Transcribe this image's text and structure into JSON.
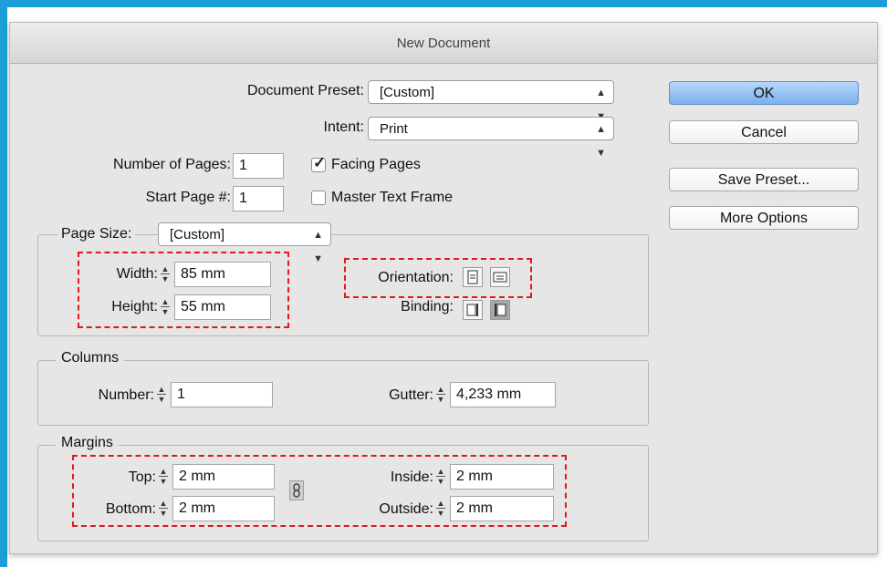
{
  "dialog": {
    "title": "New Document"
  },
  "document_preset": {
    "label": "Document Preset:",
    "value": "[Custom]"
  },
  "intent": {
    "label": "Intent:",
    "value": "Print"
  },
  "number_of_pages": {
    "label": "Number of Pages:",
    "value": "1"
  },
  "start_page": {
    "label": "Start Page #:",
    "value": "1"
  },
  "facing_pages": {
    "label": "Facing Pages",
    "checked": true
  },
  "master_text_frame": {
    "label": "Master Text Frame",
    "checked": false
  },
  "buttons": {
    "ok": "OK",
    "cancel": "Cancel",
    "save_preset": "Save Preset...",
    "more_options": "More Options"
  },
  "page_size": {
    "label": "Page Size:",
    "value": "[Custom]",
    "width": {
      "label": "Width:",
      "value": "85 mm"
    },
    "height": {
      "label": "Height:",
      "value": "55 mm"
    },
    "orientation": {
      "label": "Orientation:",
      "icons": [
        "portrait-orientation-icon",
        "landscape-orientation-icon"
      ]
    },
    "binding": {
      "label": "Binding:",
      "icons": [
        "left-to-right-binding-icon",
        "right-to-left-binding-icon"
      ],
      "selected": 1
    }
  },
  "columns": {
    "title": "Columns",
    "number": {
      "label": "Number:",
      "value": "1"
    },
    "gutter": {
      "label": "Gutter:",
      "value": "4,233 mm"
    }
  },
  "margins": {
    "title": "Margins",
    "top": {
      "label": "Top:",
      "value": "2 mm"
    },
    "bottom": {
      "label": "Bottom:",
      "value": "2 mm"
    },
    "inside": {
      "label": "Inside:",
      "value": "2 mm"
    },
    "outside": {
      "label": "Outside:",
      "value": "2 mm"
    }
  },
  "highlight_color": "#e01a1a",
  "frame_color": "#1aa0d6"
}
